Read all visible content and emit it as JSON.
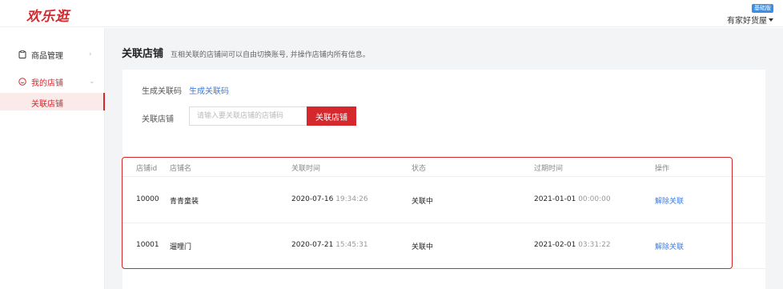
{
  "header": {
    "logo": "欢乐逛",
    "version_badge": "基础版",
    "user_name": "有家好货屋"
  },
  "sidebar": {
    "items": [
      {
        "label": "商品管理",
        "icon": "clipboard-icon",
        "expanded": false
      },
      {
        "label": "我的店铺",
        "icon": "smile-circle-icon",
        "expanded": true,
        "children": [
          {
            "label": "关联店铺",
            "active": true
          }
        ]
      }
    ]
  },
  "page": {
    "title": "关联店铺",
    "description": "互相关联的店铺间可以自由切换账号, 并操作店铺内所有信息。"
  },
  "form": {
    "code_label": "生成关联码",
    "code_link": "生成关联码",
    "store_label": "关联店铺",
    "store_placeholder": "请输入要关联店铺的店铺码",
    "store_value": "",
    "submit_label": "关联店铺"
  },
  "table": {
    "columns": [
      "店铺id",
      "店铺名",
      "关联时间",
      "状态",
      "过期时间",
      "操作"
    ],
    "rows": [
      {
        "id": "10000",
        "name": "青青童装",
        "link_date": "2020-07-16",
        "link_time": "19:34:26",
        "status": "关联中",
        "expire_date": "2021-01-01",
        "expire_time": "00:00:00",
        "action": "解除关联"
      },
      {
        "id": "10001",
        "name": "遛哩门",
        "link_date": "2020-07-21",
        "link_time": "15:45:31",
        "status": "关联中",
        "expire_date": "2021-02-01",
        "expire_time": "03:31:22",
        "action": "解除关联"
      }
    ]
  },
  "colors": {
    "brand": "#d4282d",
    "link": "#3a7be0",
    "badge": "#3a8ee6"
  }
}
